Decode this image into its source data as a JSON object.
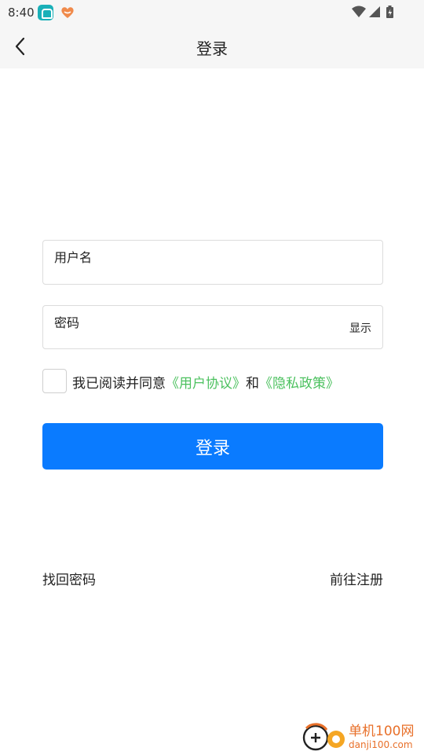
{
  "status_bar": {
    "time": "8:40",
    "icons": [
      "app-icon",
      "app-icon",
      "wifi-icon",
      "signal-icon",
      "battery-icon"
    ]
  },
  "header": {
    "title": "登录",
    "back_icon": "chevron-left-icon"
  },
  "form": {
    "username": {
      "placeholder": "用户名",
      "value": ""
    },
    "password": {
      "placeholder": "密码",
      "value": "",
      "toggle_label": "显示"
    },
    "agreement": {
      "checked": false,
      "prefix": "我已阅读并同意",
      "terms_link": "《用户协议》",
      "conjunction": "和",
      "privacy_link": "《隐私政策》"
    },
    "submit_label": "登录"
  },
  "footer_links": {
    "forgot": "找回密码",
    "register": "前往注册"
  },
  "watermark": {
    "name": "单机100网",
    "url": "danji100.com"
  },
  "colors": {
    "primary": "#0a7bff",
    "link_green": "#4cc15f",
    "header_bg": "#f6f6f6",
    "watermark": "#e8702a"
  }
}
